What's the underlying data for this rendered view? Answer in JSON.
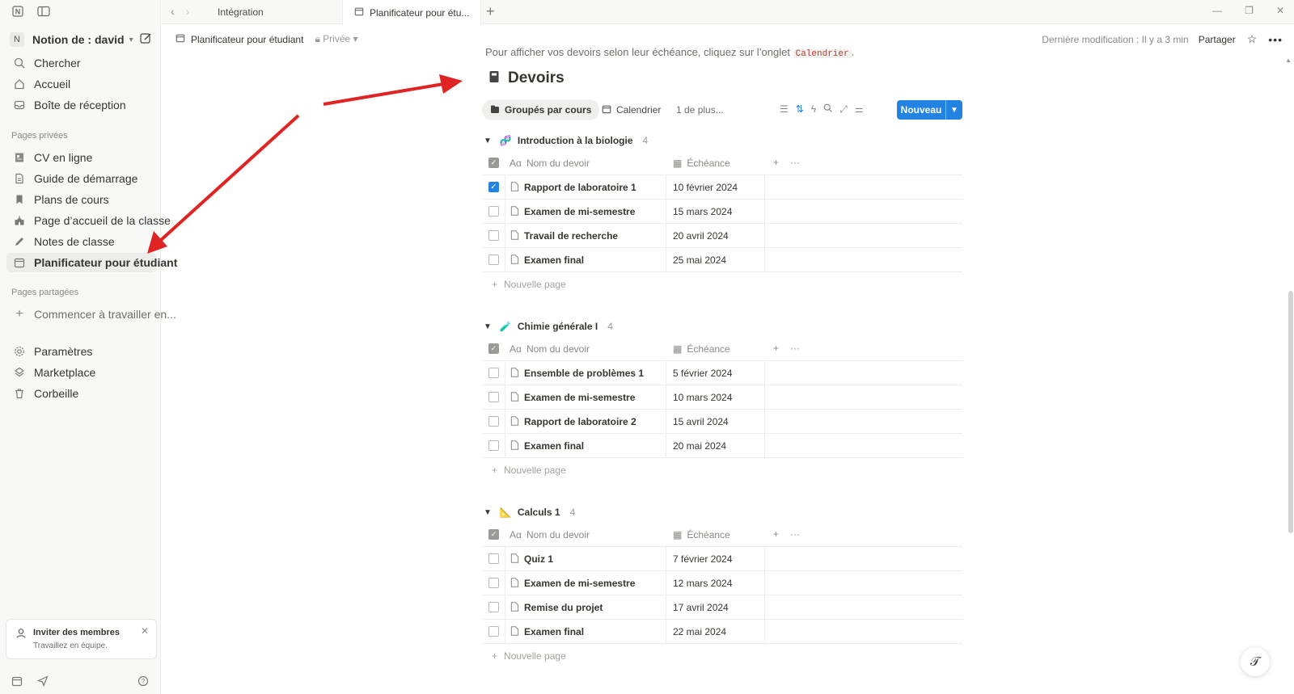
{
  "tabs": {
    "items": [
      {
        "label": "Intégration"
      },
      {
        "label": "Planificateur pour étu..."
      }
    ]
  },
  "workspace": {
    "initial": "N",
    "name": "Notion de : david"
  },
  "sidebar": {
    "top_items": [
      {
        "label": "Chercher",
        "icon": "search-icon"
      },
      {
        "label": "Accueil",
        "icon": "home-icon"
      },
      {
        "label": "Boîte de réception",
        "icon": "inbox-icon"
      }
    ],
    "private_heading": "Pages privées",
    "private_items": [
      {
        "label": "CV en ligne",
        "icon": "resume-icon"
      },
      {
        "label": "Guide de démarrage",
        "icon": "page-icon"
      },
      {
        "label": "Plans de cours",
        "icon": "bookmark-icon"
      },
      {
        "label": "Page d’accueil de la classe",
        "icon": "school-icon"
      },
      {
        "label": "Notes de classe",
        "icon": "pencil-icon"
      },
      {
        "label": "Planificateur pour étudiant",
        "icon": "calendar-icon",
        "active": true
      }
    ],
    "shared_heading": "Pages partagées",
    "shared_items": [
      {
        "label": "Commencer à travailler en...",
        "icon": "plus-icon"
      }
    ],
    "bottom_items": [
      {
        "label": "Paramètres",
        "icon": "gear-icon"
      },
      {
        "label": "Marketplace",
        "icon": "marketplace-icon"
      },
      {
        "label": "Corbeille",
        "icon": "trash-icon"
      }
    ],
    "invite": {
      "title": "Inviter des membres",
      "subtitle": "Travaillez en équipe."
    }
  },
  "header": {
    "breadcrumb": "Planificateur pour étudiant",
    "privacy": "Privée",
    "last_edit": "Dernière modification : Il y a 3 min",
    "share": "Partager"
  },
  "content": {
    "intro_text": "Pour afficher vos devoirs selon leur échéance, cliquez sur l’onglet",
    "intro_code": "Calendrier",
    "intro_end": ".",
    "db_title": "Devoirs",
    "views": [
      "Groupés par cours",
      "Calendrier",
      "1 de plus..."
    ],
    "new_button": "Nouveau",
    "col_name": "Nom du devoir",
    "col_due": "Échéance",
    "new_page": "Nouvelle page",
    "groups": [
      {
        "title": "Introduction à la biologie",
        "emoji": "🧬",
        "count": "4",
        "rows": [
          {
            "name": "Rapport de laboratoire 1",
            "due": "10 février 2024",
            "checked": true
          },
          {
            "name": "Examen de mi-semestre",
            "due": "15 mars 2024",
            "checked": false
          },
          {
            "name": "Travail de recherche",
            "due": "20 avril 2024",
            "checked": false
          },
          {
            "name": "Examen final",
            "due": "25 mai 2024",
            "checked": false
          }
        ]
      },
      {
        "title": "Chimie générale I",
        "emoji": "🧪",
        "count": "4",
        "rows": [
          {
            "name": "Ensemble de problèmes 1",
            "due": "5 février 2024",
            "checked": false
          },
          {
            "name": "Examen de mi-semestre",
            "due": "10 mars 2024",
            "checked": false
          },
          {
            "name": "Rapport de laboratoire 2",
            "due": "15 avril 2024",
            "checked": false
          },
          {
            "name": "Examen final",
            "due": "20 mai 2024",
            "checked": false
          }
        ]
      },
      {
        "title": "Calculs 1",
        "emoji": "📐",
        "count": "4",
        "rows": [
          {
            "name": "Quiz 1",
            "due": "7 février 2024",
            "checked": false
          },
          {
            "name": "Examen de mi-semestre",
            "due": "12 mars 2024",
            "checked": false
          },
          {
            "name": "Remise du projet",
            "due": "17 avril 2024",
            "checked": false
          },
          {
            "name": "Examen final",
            "due": "22 mai 2024",
            "checked": false
          }
        ]
      }
    ]
  },
  "annotation_color": "#e02424",
  "accent_color": "#2383e2"
}
